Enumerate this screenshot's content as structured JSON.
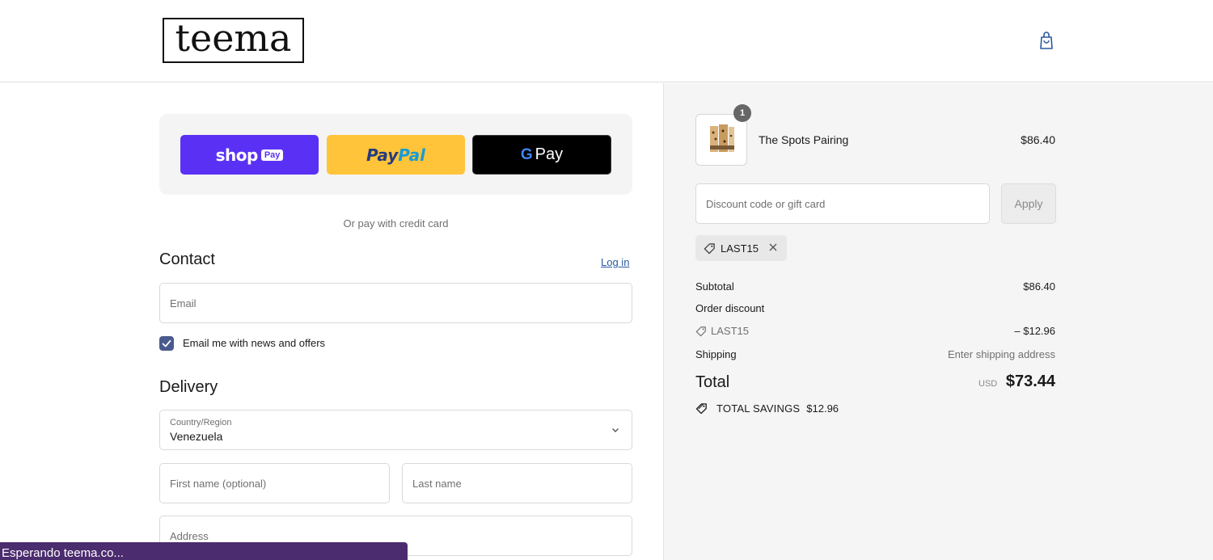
{
  "header": {
    "logo_text": "teema"
  },
  "express": {
    "shop_label": "shop",
    "shop_pill": "Pay",
    "paypal_part1": "Pay",
    "paypal_part2": "Pal",
    "gpay_g": "G",
    "gpay_label": "Pay"
  },
  "or_pay": "Or pay with credit card",
  "contact": {
    "title": "Contact",
    "login": "Log in",
    "email_placeholder": "Email",
    "newsletter_label": "Email me with news and offers",
    "newsletter_checked": true
  },
  "delivery": {
    "title": "Delivery",
    "country_label": "Country/Region",
    "country_value": "Venezuela",
    "first_name_placeholder": "First name (optional)",
    "last_name_placeholder": "Last name",
    "address_placeholder": "Address"
  },
  "status_bar": "Esperando teema.co...",
  "summary": {
    "item": {
      "name": "The Spots Pairing",
      "price": "$86.40",
      "quantity": "1"
    },
    "discount_placeholder": "Discount code or gift card",
    "apply_label": "Apply",
    "applied_code": "LAST15",
    "subtotal_label": "Subtotal",
    "subtotal_value": "$86.40",
    "order_discount_label": "Order discount",
    "discount_code": "LAST15",
    "discount_value": "– $12.96",
    "shipping_label": "Shipping",
    "shipping_value": "Enter shipping address",
    "total_label": "Total",
    "total_currency": "USD",
    "total_value": "$73.44",
    "savings_label": "TOTAL SAVINGS",
    "savings_value": "$12.96"
  },
  "colors": {
    "shop_pay": "#5a31f4",
    "paypal": "#ffc439",
    "gpay": "#000000",
    "checkbox": "#4a5a8c",
    "status_bar": "#4b2c6e"
  }
}
